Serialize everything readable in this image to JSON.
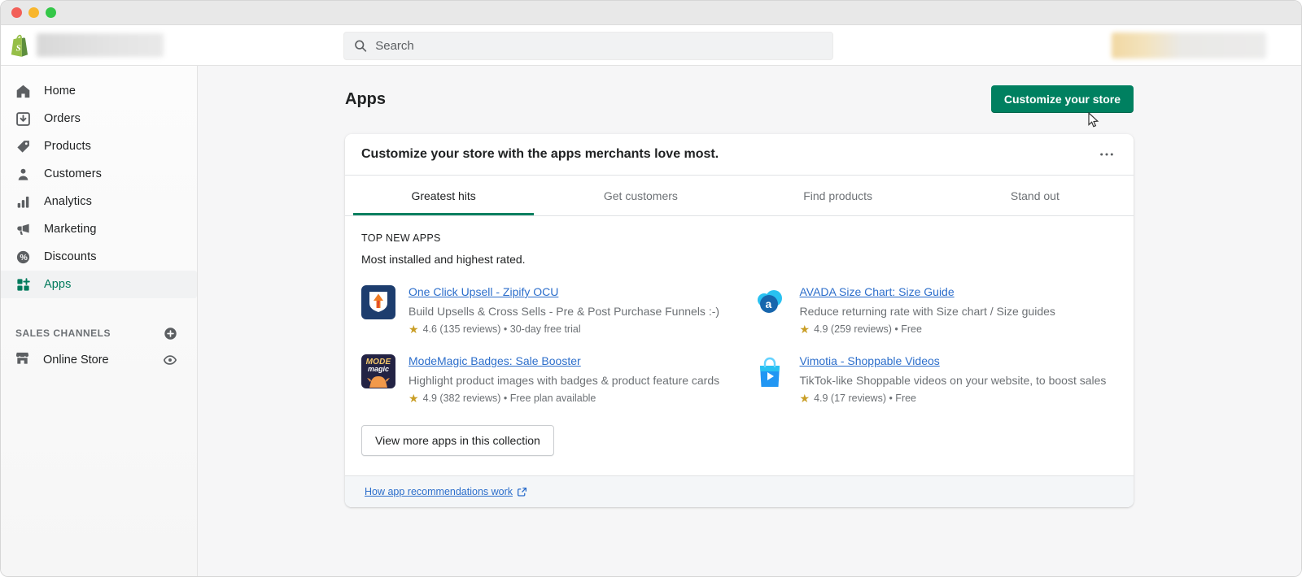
{
  "window": {
    "traffic_lights": [
      "#f25f58",
      "#f8b62d",
      "#34c748"
    ]
  },
  "header": {
    "search_placeholder": "Search"
  },
  "sidebar": {
    "items": [
      {
        "label": "Home",
        "icon": "home-icon"
      },
      {
        "label": "Orders",
        "icon": "orders-icon"
      },
      {
        "label": "Products",
        "icon": "products-icon"
      },
      {
        "label": "Customers",
        "icon": "customers-icon"
      },
      {
        "label": "Analytics",
        "icon": "analytics-icon"
      },
      {
        "label": "Marketing",
        "icon": "marketing-icon"
      },
      {
        "label": "Discounts",
        "icon": "discounts-icon"
      },
      {
        "label": "Apps",
        "icon": "apps-icon",
        "selected": true
      }
    ],
    "sales_channels_label": "SALES CHANNELS",
    "channels": [
      {
        "label": "Online Store",
        "icon": "storefront-icon"
      }
    ]
  },
  "main": {
    "page_title": "Apps",
    "customize_button": "Customize your store",
    "card": {
      "header": "Customize your store with the apps merchants love most.",
      "tabs": [
        "Greatest hits",
        "Get customers",
        "Find products",
        "Stand out"
      ],
      "active_tab": "Greatest hits",
      "section_title": "TOP NEW APPS",
      "section_subtitle": "Most installed and highest rated.",
      "apps": [
        {
          "name": "One Click Upsell - Zipify OCU",
          "description": "Build Upsells & Cross Sells - Pre & Post Purchase Funnels :-)",
          "rating_line": "4.6 (135 reviews) • 30-day free trial"
        },
        {
          "name": "AVADA Size Chart: Size Guide",
          "description": "Reduce returning rate with Size chart / Size guides",
          "rating_line": "4.9 (259 reviews) • Free"
        },
        {
          "name": "ModeMagic Badges: Sale Booster",
          "description": "Highlight product images with badges & product feature cards",
          "rating_line": "4.9 (382 reviews) • Free plan available"
        },
        {
          "name": "Vimotia - Shoppable Videos",
          "description": "TikTok-like Shoppable videos on your website, to boost sales",
          "rating_line": "4.9 (17 reviews) • Free"
        }
      ],
      "icon_text": {
        "modemagic_top": "MODE",
        "modemagic_bottom": "magic",
        "avada_letter": "a"
      },
      "view_more_button": "View more apps in this collection",
      "footer_link": "How app recommendations work"
    }
  },
  "colors": {
    "accent_green": "#008060",
    "link_blue": "#2c6ecb",
    "star_gold": "#c99e25",
    "text_primary": "#202223",
    "text_secondary": "#6d7175"
  }
}
